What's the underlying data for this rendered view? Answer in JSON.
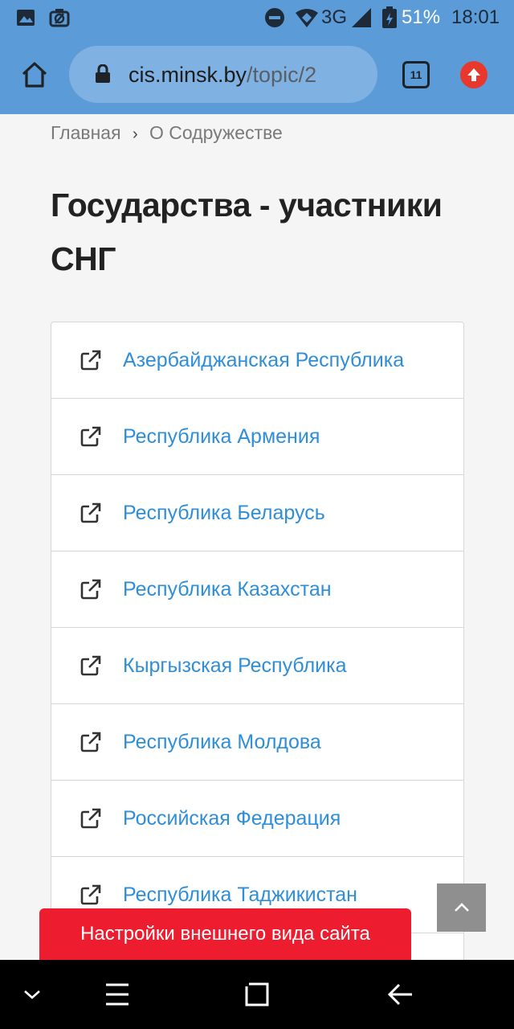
{
  "status_bar": {
    "network": "3G",
    "battery": "51%",
    "time": "18:01"
  },
  "browser": {
    "url_host": "cis.minsk.by",
    "url_path": "/topic/2",
    "tab_count": "11"
  },
  "breadcrumb": {
    "home": "Главная",
    "current": "О Содружестве"
  },
  "page_title": "Государства - участники СНГ",
  "states": [
    {
      "label": "Азербайджанская Республика"
    },
    {
      "label": "Республика Армения"
    },
    {
      "label": "Республика Беларусь"
    },
    {
      "label": "Республика Казахстан"
    },
    {
      "label": "Кыргызская Республика"
    },
    {
      "label": "Республика Молдова"
    },
    {
      "label": "Российская Федерация"
    },
    {
      "label": "Республика Таджикистан"
    }
  ],
  "appearance_button": "Настройки внешнего вида сайта",
  "icons": {
    "list_item": "external-link-icon",
    "scroll_top": "chevron-up-icon"
  },
  "colors": {
    "browser_bar": "#5b9bd8",
    "link": "#2f8ed8",
    "accent_red": "#ed1c2e"
  }
}
